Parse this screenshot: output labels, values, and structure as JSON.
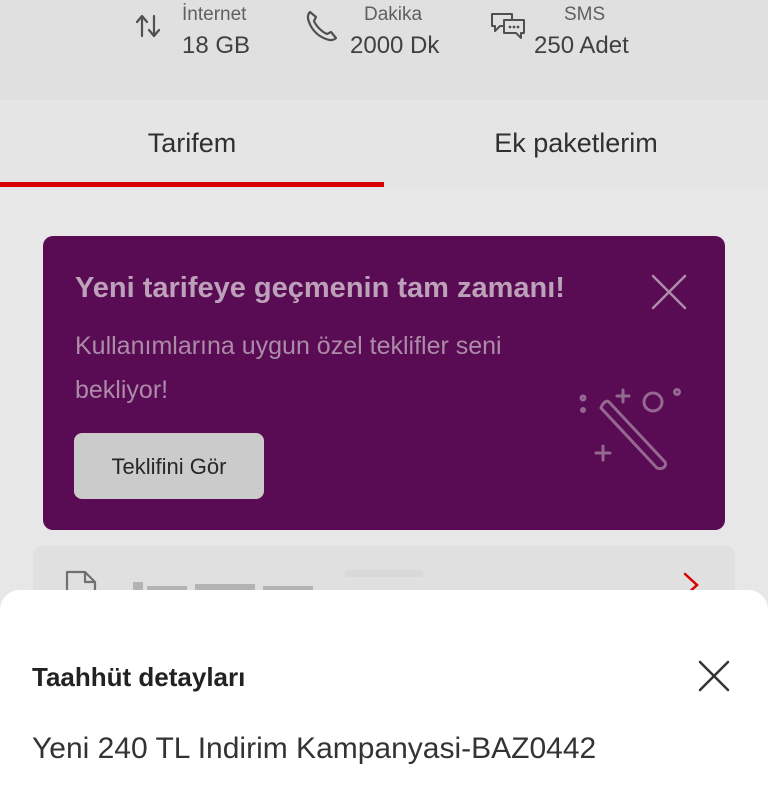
{
  "usage": {
    "items": [
      {
        "label": "İnternet",
        "value": "18 GB",
        "icon": "data-transfer-icon"
      },
      {
        "label": "Dakika",
        "value": "2000 Dk",
        "icon": "phone-icon"
      },
      {
        "label": "SMS",
        "value": "250 Adet",
        "icon": "chat-bubbles-icon"
      }
    ]
  },
  "tabs": {
    "items": [
      {
        "label": "Tarifem",
        "active": true
      },
      {
        "label": "Ek paketlerim",
        "active": false
      }
    ],
    "accent": "#e60000"
  },
  "promo": {
    "title": "Yeni tarifeye geçmenin tam zamanı!",
    "text": "Kullanımlarına uygun özel teklifler seni bekliyor!",
    "button_label": "Teklifini Gör",
    "background": "#5e0d58"
  },
  "sheet": {
    "title": "Taahhüt detayları",
    "body": "Yeni 240 TL Indirim Kampanyasi-BAZ0442"
  }
}
